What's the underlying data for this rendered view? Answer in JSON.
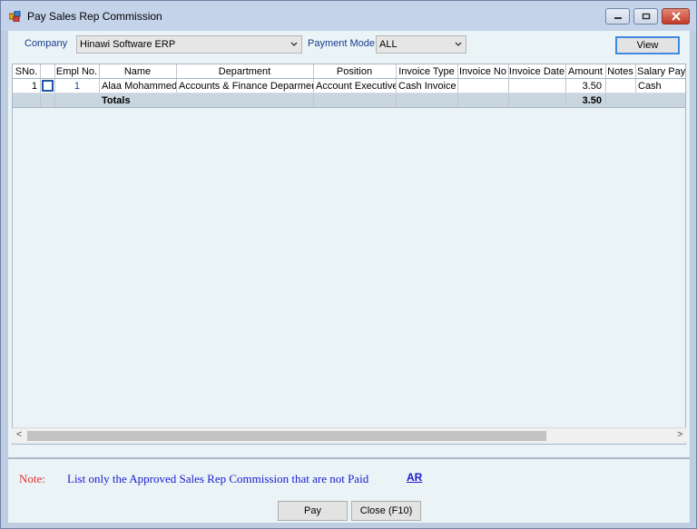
{
  "window": {
    "title": "Pay Sales Rep Commission",
    "min_icon": "minimize-icon",
    "max_icon": "maximize-icon",
    "close_icon": "close-icon"
  },
  "filters": {
    "company_label": "Company",
    "company_value": "Hinawi Software ERP",
    "payment_mode_label": "Payment Mode",
    "payment_mode_value": "ALL",
    "view_button": "View"
  },
  "grid": {
    "columns": [
      "SNo.",
      "",
      "Empl No.",
      "Name",
      "Department",
      "Position",
      "Invoice Type",
      "Invoice No",
      "Invoice Date",
      "Amount",
      "Notes",
      "Salary Payr"
    ],
    "rows": [
      {
        "sno": "1",
        "selected": false,
        "empl_no": "1",
        "name": "Alaa Mohammed",
        "department": "Accounts & Finance Deparment",
        "position": "Account Executive",
        "invoice_type": "Cash Invoice",
        "invoice_no": "",
        "invoice_date": "",
        "amount": "3.50",
        "notes": "",
        "salary_payment": "Cash"
      }
    ],
    "totals_label": "Totals",
    "totals_amount": "3.50"
  },
  "scrollbar": {
    "left_arrow": "<",
    "right_arrow": ">"
  },
  "footer": {
    "note_label": "Note:",
    "note_text": "List only the Approved Sales Rep Commission that are not Paid",
    "ar_link": "AR",
    "pay_button": "Pay",
    "close_button": "Close (F10)"
  },
  "colors": {
    "label_blue": "#1a3b8f",
    "note_red": "#e03030",
    "note_blue": "#1a1ad0"
  }
}
